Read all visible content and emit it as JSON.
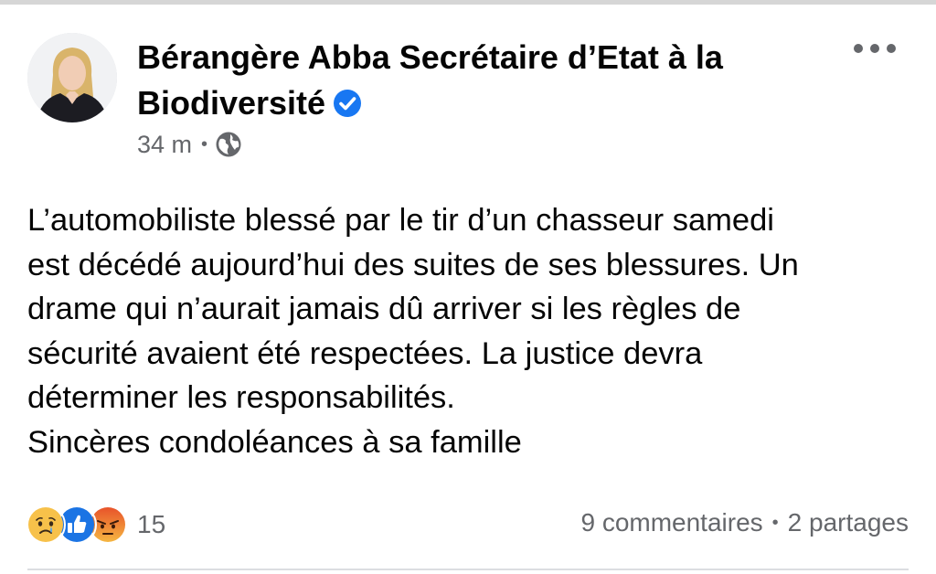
{
  "post": {
    "author": "Bérangère Abba Secrétaire d’Etat à la Biodiversité",
    "verified_icon": "verified-badge-icon",
    "timestamp": "34 m",
    "separator": "•",
    "audience_icon": "globe-icon",
    "more_icon": "more-options-icon",
    "message_lines": [
      "L’automobiliste blessé par le tir d’un chasseur samedi",
      "est décédé aujourd’hui des suites de ses blessures. Un",
      "drame qui n’aurait jamais dû arriver si les règles de",
      "sécurité avaient été respectées. La justice devra",
      "déterminer les responsabilités.",
      "Sincères condoléances à sa famille"
    ]
  },
  "footer": {
    "reaction_icons": [
      "sad-reaction-icon",
      "like-reaction-icon",
      "angry-reaction-icon"
    ],
    "reaction_count": "15",
    "comments": "9 commentaires",
    "separator": "•",
    "shares": "2 partages"
  },
  "colors": {
    "text": "#050505",
    "secondary_text": "#65676b",
    "verified_blue": "#1877f2",
    "like_blue": "#1b74e4",
    "sad_yellow": "#f7c14a",
    "angry_orange": "#e9710f"
  }
}
